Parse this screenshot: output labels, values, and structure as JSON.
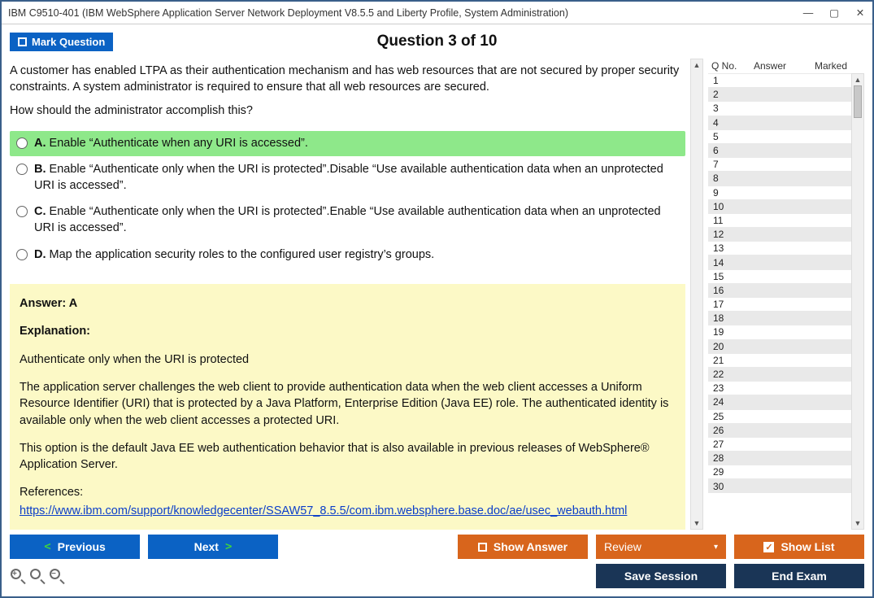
{
  "window": {
    "title": "IBM C9510-401 (IBM WebSphere Application Server Network Deployment V8.5.5 and Liberty Profile, System Administration)"
  },
  "header": {
    "mark_label": "Mark Question",
    "question_heading": "Question 3 of 10"
  },
  "question": {
    "stem1": "A customer has enabled LTPA as their authentication mechanism and has web resources that are not secured by proper security constraints. A system administrator is required to ensure that all web resources are secured.",
    "stem2": "How should the administrator accomplish this?",
    "options": [
      {
        "letter": "A.",
        "text": "Enable “Authenticate when any URI is accessed”.",
        "correct": true
      },
      {
        "letter": "B.",
        "text": "Enable “Authenticate only when the URI is protected”.Disable “Use available authentication data when an unprotected URI is accessed”.",
        "correct": false
      },
      {
        "letter": "C.",
        "text": "Enable “Authenticate only when the URI is protected”.Enable “Use available authentication data when an unprotected URI is accessed”.",
        "correct": false
      },
      {
        "letter": "D.",
        "text": "Map the application security roles to the configured user registry’s groups.",
        "correct": false
      }
    ]
  },
  "answer": {
    "heading": "Answer: A",
    "exp_heading": "Explanation:",
    "p1": "Authenticate only when the URI is protected",
    "p2": "The application server challenges the web client to provide authentication data when the web client accesses a Uniform Resource Identifier (URI) that is protected by a Java Platform, Enterprise Edition (Java EE) role. The authenticated identity is available only when the web client accesses a protected URI.",
    "p3": "This option is the default Java EE web authentication behavior that is also available in previous releases of WebSphere® Application Server.",
    "ref_label": "References:",
    "ref_link": "https://www.ibm.com/support/knowledgecenter/SSAW57_8.5.5/com.ibm.websphere.base.doc/ae/usec_webauth.html"
  },
  "sidebar": {
    "cols": {
      "q": "Q No.",
      "answer": "Answer",
      "marked": "Marked"
    },
    "rows": [
      1,
      2,
      3,
      4,
      5,
      6,
      7,
      8,
      9,
      10,
      11,
      12,
      13,
      14,
      15,
      16,
      17,
      18,
      19,
      20,
      21,
      22,
      23,
      24,
      25,
      26,
      27,
      28,
      29,
      30
    ]
  },
  "footer": {
    "previous": "Previous",
    "next": "Next",
    "show_answer": "Show Answer",
    "review": "Review",
    "show_list": "Show List",
    "save_session": "Save Session",
    "end_exam": "End Exam"
  }
}
